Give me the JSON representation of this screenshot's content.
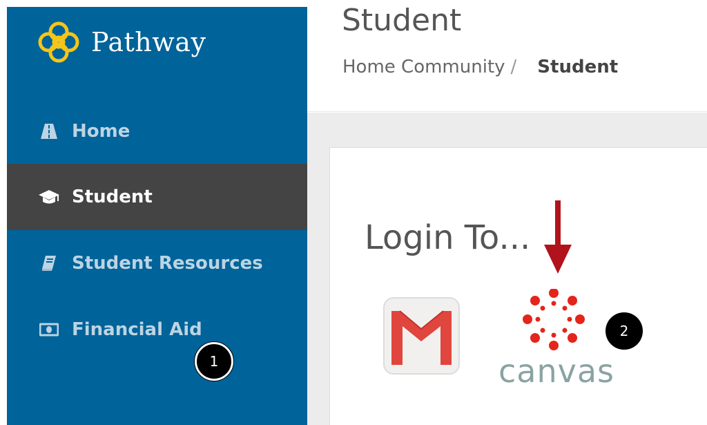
{
  "brand": {
    "name": "Pathway",
    "logo_color": "#f5c518"
  },
  "sidebar": {
    "background": "#00639a",
    "active_background": "#444444",
    "items": [
      {
        "label": "Home",
        "icon": "road-icon",
        "active": false
      },
      {
        "label": "Student",
        "icon": "graduation-cap-icon",
        "active": true
      },
      {
        "label": "Student Resources",
        "icon": "book-icon",
        "active": false
      },
      {
        "label": "Financial Aid",
        "icon": "money-icon",
        "active": false
      }
    ]
  },
  "header": {
    "title": "Student",
    "breadcrumb": {
      "parent": "Home Community",
      "separator": "/",
      "current": "Student"
    }
  },
  "main": {
    "heading": "Login To...",
    "apps": [
      {
        "name": "gmail",
        "icon": "gmail-icon",
        "color": "#e0463d"
      },
      {
        "name": "canvas",
        "label": "canvas",
        "icon": "canvas-logo-icon",
        "color": "#e3251b"
      }
    ]
  },
  "annotations": {
    "step1": "1",
    "step2": "2",
    "arrow_color": "#b2121b"
  }
}
